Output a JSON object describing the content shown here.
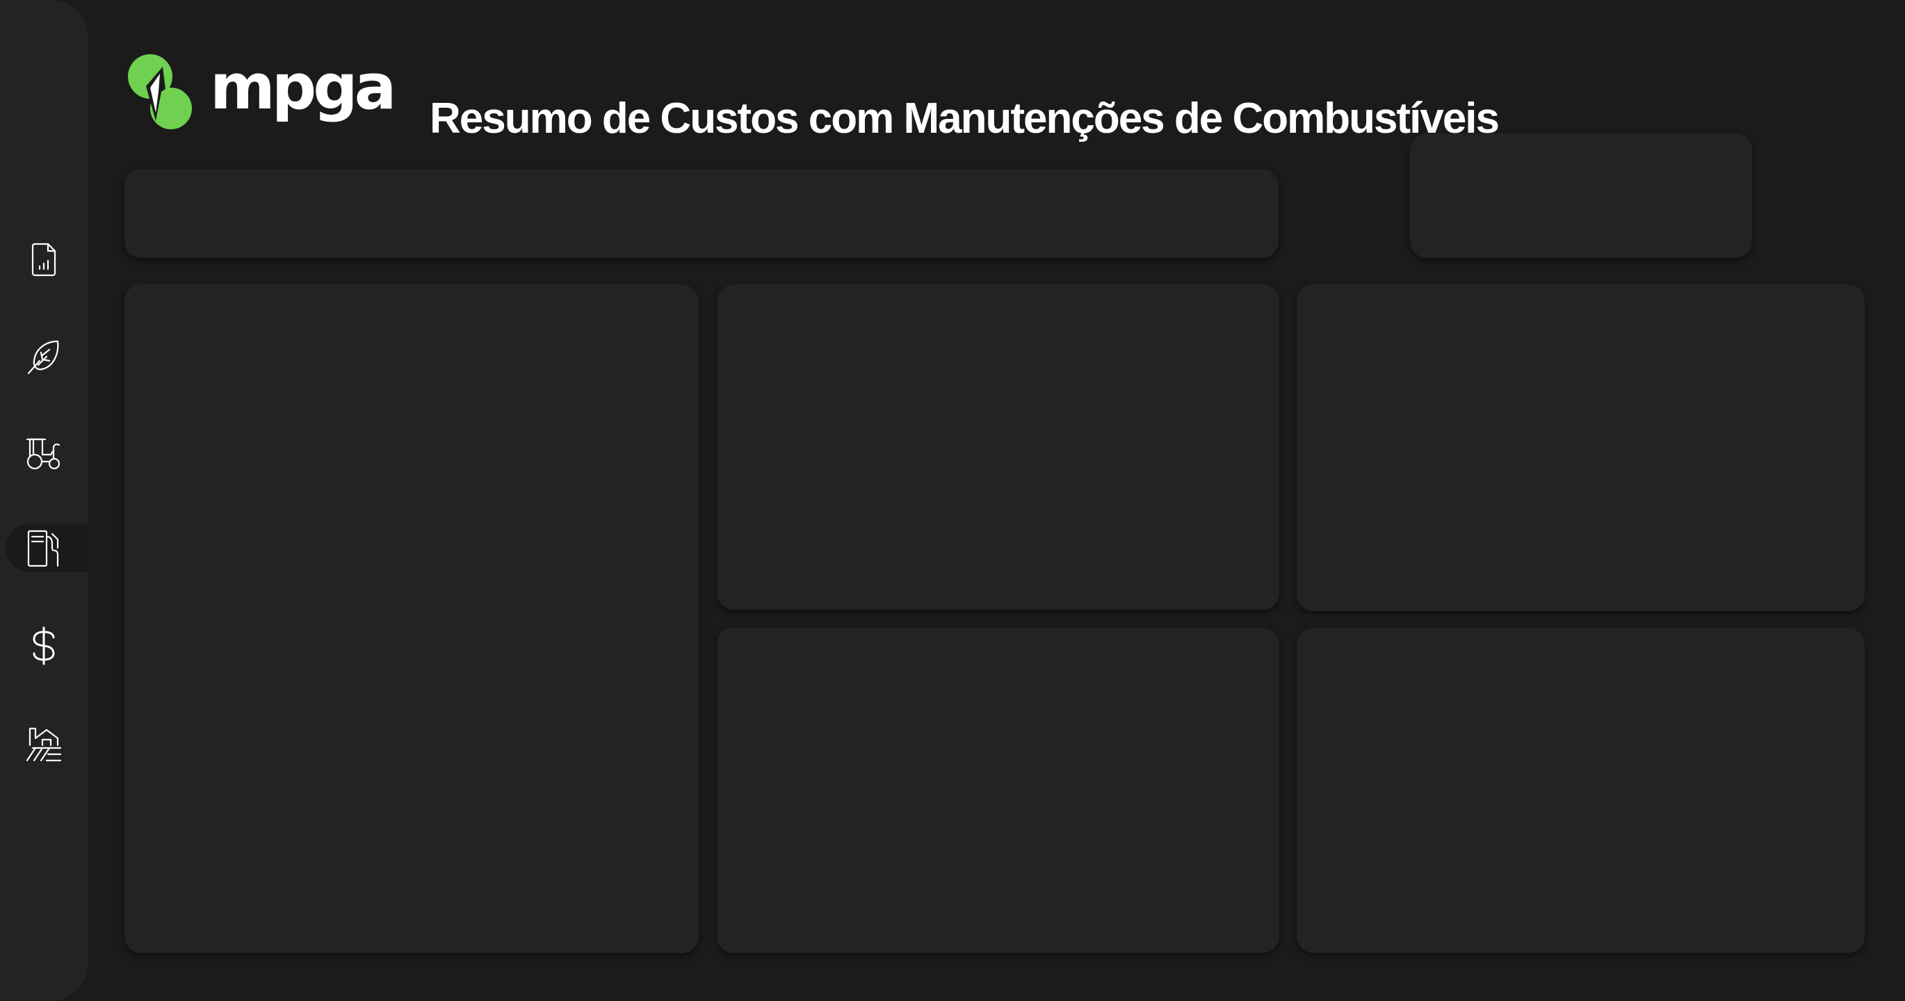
{
  "header": {
    "logo_text": "mpga",
    "title": "Resumo de Custos com Manutenções de Combustíveis"
  },
  "sidebar": {
    "items": [
      {
        "icon": "report-chart-icon",
        "active": false
      },
      {
        "icon": "leaf-crop-icon",
        "active": false
      },
      {
        "icon": "tractor-icon",
        "active": false
      },
      {
        "icon": "fuel-pump-icon",
        "active": true
      },
      {
        "icon": "dollar-icon",
        "active": false
      },
      {
        "icon": "farm-field-icon",
        "active": false
      }
    ]
  },
  "colors": {
    "background": "#1b1b1b",
    "sidebar": "#232323",
    "card": "#232323",
    "brand_green": "#6fd14f",
    "text": "#ffffff"
  }
}
